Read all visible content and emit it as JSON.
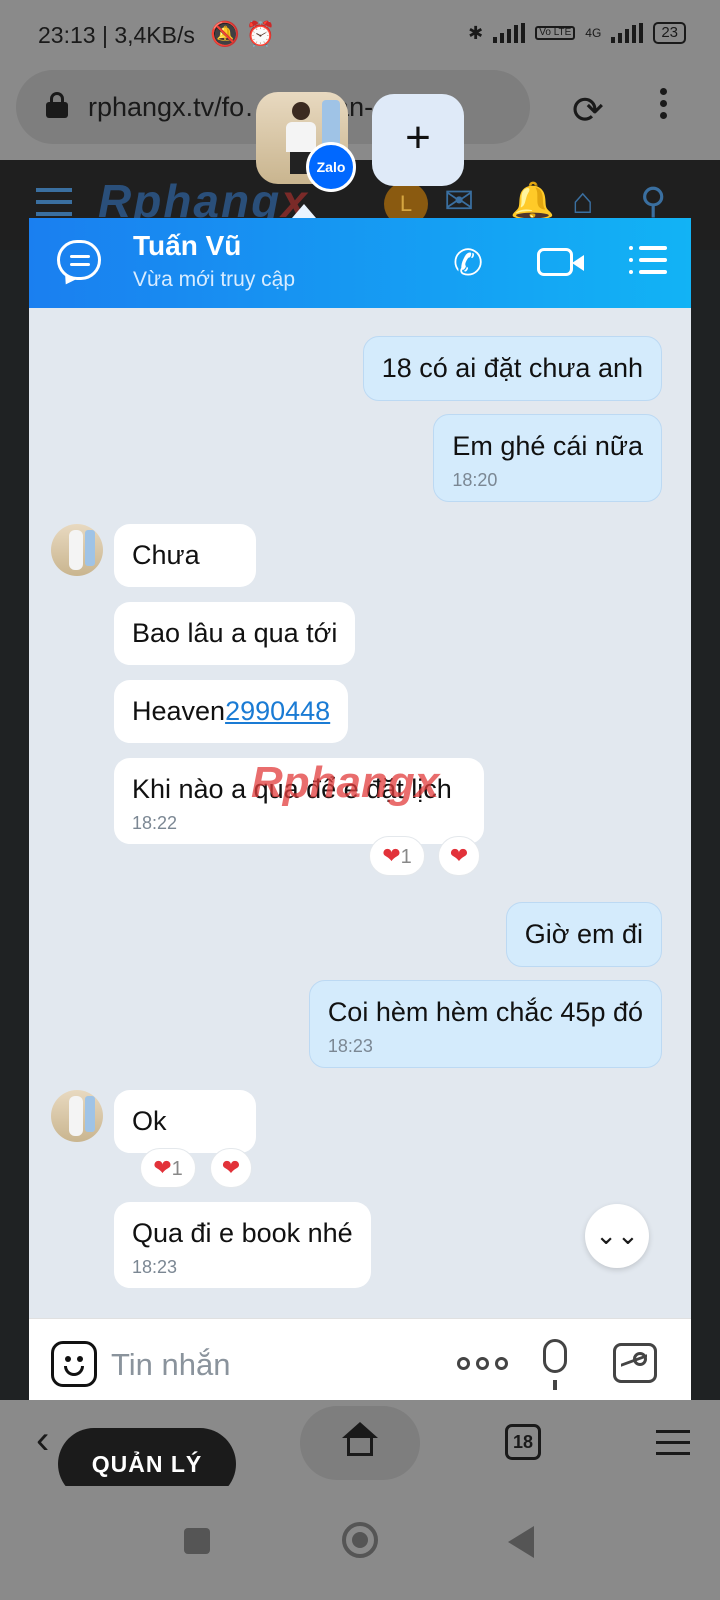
{
  "status_bar": {
    "time": "23:13",
    "speed": "3,4KB/s",
    "battery": "23",
    "volte": "Vo LTE",
    "network": "4G"
  },
  "browser": {
    "url": "rphangx.tv/fo…dia…an-c",
    "tab_count": "18",
    "manage_label": "QUẢN LÝ"
  },
  "site": {
    "logo_part1": "Rphang",
    "logo_part2": "x",
    "user_initial": "L"
  },
  "chat_heads": {
    "badge": "Zalo",
    "plus": "+"
  },
  "chat": {
    "contact_name": "Tuấn Vũ",
    "contact_status": "Vừa mới truy cập",
    "watermark_part1": "Rphang",
    "watermark_part2": "x",
    "composer_placeholder": "Tin nhắn",
    "messages": [
      {
        "from": "me",
        "text": "18 có ai đặt chưa anh"
      },
      {
        "from": "me",
        "text": "Em ghé cái nữa",
        "time": "18:20"
      },
      {
        "from": "them",
        "text": "Chưa"
      },
      {
        "from": "them",
        "text": "Bao lâu a qua tới"
      },
      {
        "from": "them",
        "text": "Heaven",
        "link": "2990448"
      },
      {
        "from": "them",
        "text": "Khi nào a qua để e đặt lịch",
        "time": "18:22",
        "reaction_count": "1"
      },
      {
        "from": "me",
        "text": "Giờ em đi"
      },
      {
        "from": "me",
        "text": "Coi hèm hèm chắc 45p đó",
        "time": "18:23"
      },
      {
        "from": "them",
        "text": "Ok",
        "reaction_count": "1"
      },
      {
        "from": "them",
        "text": "Qua đi e book nhé",
        "time": "18:23"
      }
    ]
  },
  "icons": {
    "heart": "❤",
    "reload": "⟳",
    "call": "✆",
    "chevrons": "⌄",
    "back": "‹"
  }
}
